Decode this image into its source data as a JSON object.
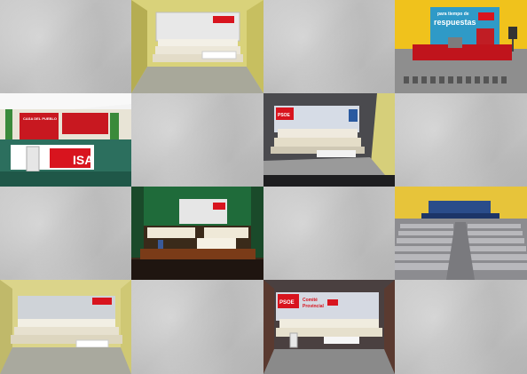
{
  "banners": {
    "slogan_top": "para tiempo de",
    "slogan_main": "respuestas",
    "casa": "CASA DEL PUEBLO",
    "psoe": "PSOE",
    "comite": "Comité",
    "provincial": "Provincial",
    "isa": "ISA"
  },
  "colors": {
    "brand_red": "#d8141e",
    "wall_yellow": "#e6c84a",
    "stage_red": "#c0141c",
    "teal": "#1f8a6e"
  }
}
